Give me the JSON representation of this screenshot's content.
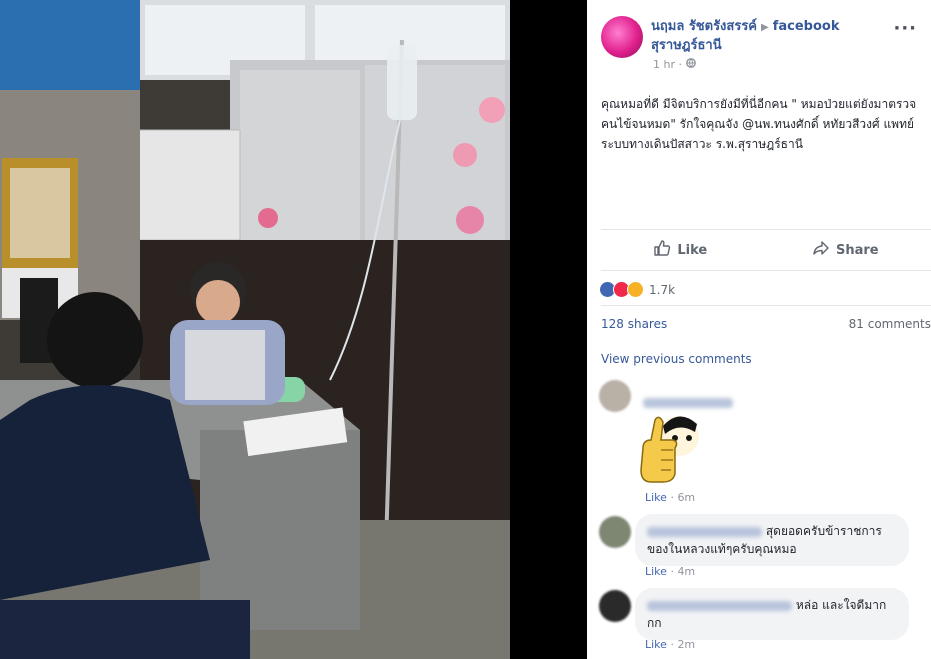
{
  "post": {
    "author": "นฤมล รัชตรังสรรค์",
    "group_line1": "facebook",
    "group_line2": "สุราษฎร์ธานี",
    "time": "1 hr",
    "more_icon": "ellipsis-icon",
    "text": "คุณหมอที่ดี มีจิตบริการยังมีที่นี่อีกคน \" หมอป่วยแต่ยังมาตรวจคนไข้จนหมด\" รักใจคุณจัง @นพ.ทนงศักดิ์ หทัยวสีวงศ์ แพทย์ระบบทางเดินปัสสาวะ ร.พ.สุราษฎร์ธานี"
  },
  "actions": {
    "like": "Like",
    "share": "Share"
  },
  "reactions": {
    "count": "1.7k",
    "types": [
      "like",
      "love",
      "wow"
    ]
  },
  "stats": {
    "shares": "128 shares",
    "comments": "81 comments"
  },
  "view_previous": "View previous comments",
  "comments": [
    {
      "text": "",
      "like": "Like",
      "time": "6m"
    },
    {
      "text": "สุดยอดครับข้าราชการของในหลวงแท้ๆครับคุณหมอ",
      "like": "Like",
      "time": "4m"
    },
    {
      "text": "หล่อ และใจดีมากกก",
      "like": "Like",
      "time": "2m"
    }
  ]
}
